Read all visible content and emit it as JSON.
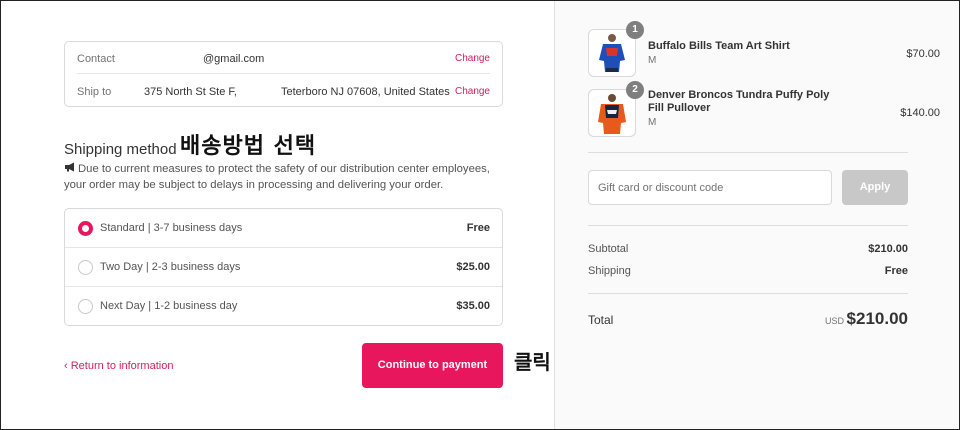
{
  "contact": {
    "label": "Contact",
    "value": "@gmail.com",
    "change_label": "Change"
  },
  "ship_to": {
    "label": "Ship to",
    "address_1": "375 North St Ste F,",
    "address_2": "Teterboro NJ 07608, United States",
    "change_label": "Change"
  },
  "shipping_method": {
    "title": "Shipping method",
    "annotation": "배송방법 선택",
    "notice": "Due to current measures to protect the safety of our distribution center employees, your order may be subject to delays in processing and delivering your order.",
    "notice_icon": "megaphone-icon",
    "options": [
      {
        "label": "Standard | 3-7 business days",
        "price": "Free",
        "selected": true
      },
      {
        "label": "Two Day | 2-3 business days",
        "price": "$25.00",
        "selected": false
      },
      {
        "label": "Next Day | 1-2 business day",
        "price": "$35.00",
        "selected": false
      }
    ]
  },
  "footer": {
    "return_label": "Return to information",
    "continue_label": "Continue to payment",
    "continue_annotation": "클릭"
  },
  "cart": {
    "items": [
      {
        "quantity": "1",
        "name": "Buffalo Bills Team Art Shirt",
        "variant": "M",
        "price": "$70.00"
      },
      {
        "quantity": "2",
        "name": "Denver Broncos Tundra Puffy Poly Fill Pullover",
        "variant": "M",
        "price": "$140.00"
      }
    ],
    "discount_placeholder": "Gift card or discount code",
    "apply_label": "Apply",
    "subtotal_label": "Subtotal",
    "subtotal_value": "$210.00",
    "shipping_label": "Shipping",
    "shipping_value": "Free",
    "total_label": "Total",
    "total_currency": "USD",
    "total_value": "$210.00"
  },
  "colors": {
    "accent": "#e8175d",
    "link": "#d11f5a",
    "apply_disabled": "#c8c8c8",
    "sidebar_bg": "#fafafa"
  }
}
